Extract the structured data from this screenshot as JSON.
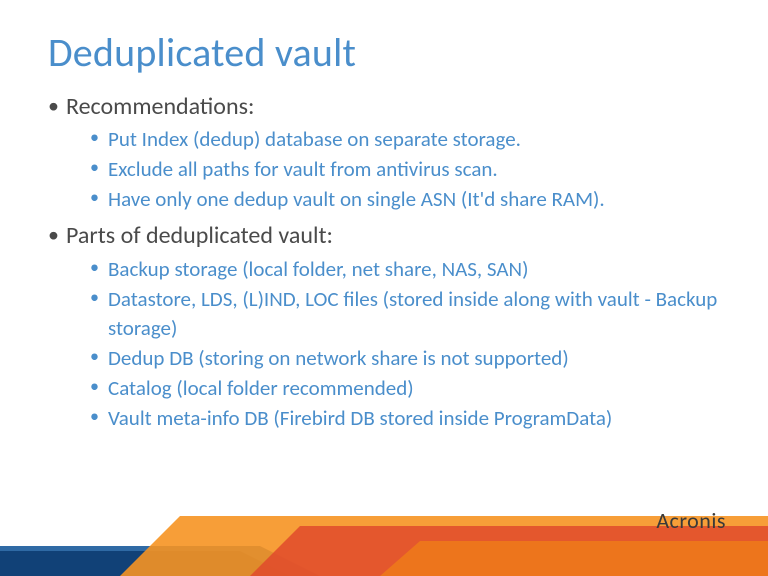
{
  "title": "Deduplicated vault",
  "sections": [
    {
      "heading": "Recommendations:",
      "items": [
        "Put Index (dedup) database on separate storage.",
        "Exclude all paths for vault from antivirus scan.",
        "Have only one dedup vault on single ASN (It'd share RAM)."
      ]
    },
    {
      "heading": "Parts of deduplicated vault:",
      "items": [
        "Backup storage (local folder, net share, NAS, SAN)",
        "Datastore, LDS, (L)IND, LOC files (stored inside along with vault - Backup storage)",
        "Dedup DB (storing on network share is not supported)",
        "Catalog (local folder recommended)",
        "Vault meta-info DB (Firebird DB stored inside ProgramData)"
      ]
    }
  ],
  "brand": "Acronis"
}
